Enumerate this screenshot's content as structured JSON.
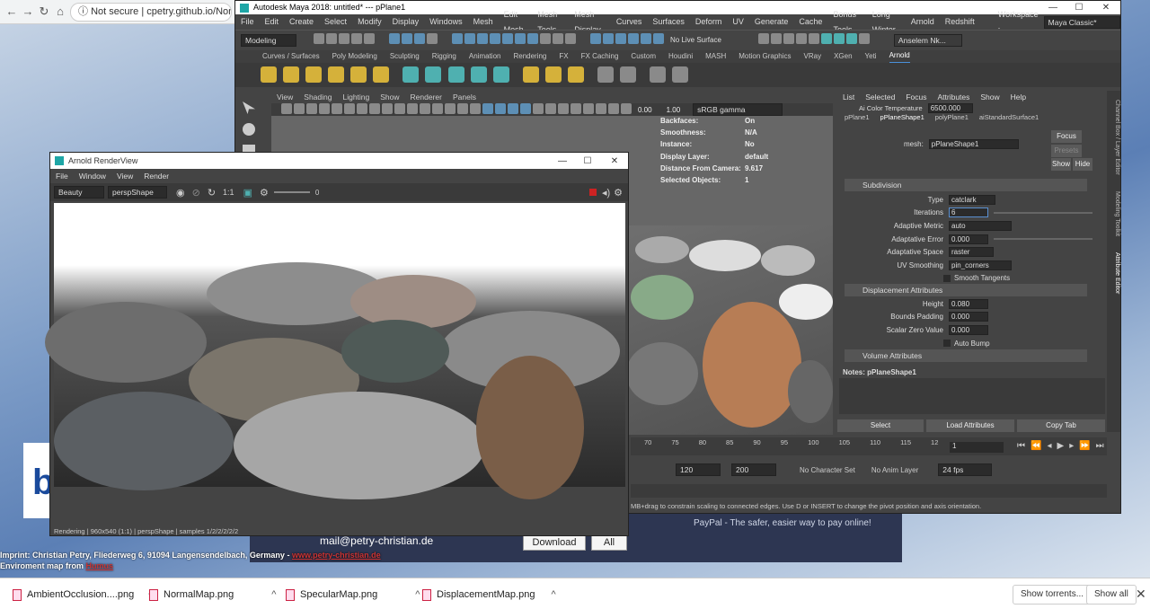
{
  "browser": {
    "security": "Not secure",
    "url": "cpetry.github.io/NormalMap"
  },
  "page": {
    "contact_email": "mail@petry-christian.de",
    "download_label": "Download",
    "all_label": "All",
    "paypal_text": "PayPal - The safer, easier way to pay online!",
    "imprint_line": "Imprint: Christian Petry, Fliederweg 6, 91094 Langensendelbach, Germany",
    "imprint_link": "www.petry-christian.de",
    "env_line": "Enviroment map from",
    "env_link": "Humus"
  },
  "downloads": {
    "items": [
      "AmbientOcclusion....png",
      "NormalMap.png",
      "SpecularMap.png",
      "DisplacementMap.png"
    ],
    "show_torrents": "Show torrents...",
    "show_all": "Show all"
  },
  "maya": {
    "title": "Autodesk Maya 2018: untitled*   ---   pPlane1",
    "menus": [
      "File",
      "Edit",
      "Create",
      "Select",
      "Modify",
      "Display",
      "Windows",
      "Mesh",
      "Edit Mesh",
      "Mesh Tools",
      "Mesh Display",
      "Curves",
      "Surfaces",
      "Deform",
      "UV",
      "Generate",
      "Cache",
      "Bonus Tools",
      "Long Winter",
      "Arnold",
      "Redshift"
    ],
    "workspace_label": "Workspace :",
    "workspace_value": "Maya Classic*",
    "mode": "Modeling",
    "live_surface": "No Live Surface",
    "user": "Anselem Nk...",
    "shelf_tabs": [
      "Curves / Surfaces",
      "Poly Modeling",
      "Sculpting",
      "Rigging",
      "Animation",
      "Rendering",
      "FX",
      "FX Caching",
      "Custom",
      "Houdini",
      "MASH",
      "Motion Graphics",
      "VRay",
      "XGen",
      "Yeti",
      "Arnold"
    ],
    "shelf_active": "Arnold",
    "viewport_menu": [
      "View",
      "Shading",
      "Lighting",
      "Show",
      "Renderer",
      "Panels"
    ],
    "vp_value1": "0.00",
    "vp_value2": "1.00",
    "colorspace": "sRGB gamma",
    "hud": [
      {
        "k": "Backfaces:",
        "v": "On"
      },
      {
        "k": "Smoothness:",
        "v": "N/A"
      },
      {
        "k": "Instance:",
        "v": "No"
      },
      {
        "k": "Display Layer:",
        "v": "default"
      },
      {
        "k": "Distance From Camera:",
        "v": "9.617"
      },
      {
        "k": "Selected Objects:",
        "v": "1"
      }
    ]
  },
  "attr": {
    "menu": [
      "List",
      "Selected",
      "Focus",
      "Attributes",
      "Show",
      "Help"
    ],
    "color_temp_label": "Ai Color Temperature",
    "color_temp_value": "6500.000",
    "tabs": [
      "pPlane1",
      "pPlaneShape1",
      "polyPlane1",
      "aiStandardSurface1"
    ],
    "mesh_label": "mesh:",
    "mesh_value": "pPlaneShape1",
    "focus": "Focus",
    "presets": "Presets",
    "show": "Show",
    "hide": "Hide",
    "subdivision": "Subdivision",
    "fields": [
      {
        "k": "Type",
        "v": "catclark"
      },
      {
        "k": "Iterations",
        "v": "6"
      },
      {
        "k": "Adaptive Metric",
        "v": "auto"
      },
      {
        "k": "Adaptative Error",
        "v": "0.000"
      },
      {
        "k": "Adaptative Space",
        "v": "raster"
      },
      {
        "k": "UV Smoothing",
        "v": "pin_corners"
      }
    ],
    "smooth_tangents": "Smooth Tangents",
    "displacement": "Displacement Attributes",
    "disp_fields": [
      {
        "k": "Height",
        "v": "0.080"
      },
      {
        "k": "Bounds Padding",
        "v": "0.000"
      },
      {
        "k": "Scalar Zero Value",
        "v": "0.000"
      }
    ],
    "auto_bump": "Auto Bump",
    "volume": "Volume Attributes",
    "notes": "Notes:  pPlaneShape1",
    "select_btn": "Select",
    "load_btn": "Load Attributes",
    "copy_btn": "Copy Tab",
    "side_tabs": [
      "Channel Box / Layer Editor",
      "Modeling Toolkit",
      "Attribute Editor"
    ]
  },
  "timeline": {
    "ticks": [
      "70",
      "75",
      "80",
      "85",
      "90",
      "95",
      "100",
      "105",
      "110",
      "115",
      "12"
    ],
    "current": "1",
    "end": "120",
    "max": "200",
    "char_set": "No Character Set",
    "anim_layer": "No Anim Layer",
    "fps": "24 fps",
    "help": "MB+drag to constrain scaling to connected edges. Use D or INSERT to change the pivot position and axis orientation."
  },
  "arnold": {
    "title": "Arnold RenderView",
    "menus": [
      "File",
      "Window",
      "View",
      "Render"
    ],
    "aov": "Beauty",
    "camera": "perspShape",
    "ratio": "1:1",
    "exposure": "0",
    "status": "Rendering  |  960x540 (1:1)  |  perspShape  |  samples 1/2/2/2/2/2"
  },
  "colors": {
    "maya_bg": "#444444",
    "accent": "#4a90d9",
    "promo": "#2d3652"
  }
}
